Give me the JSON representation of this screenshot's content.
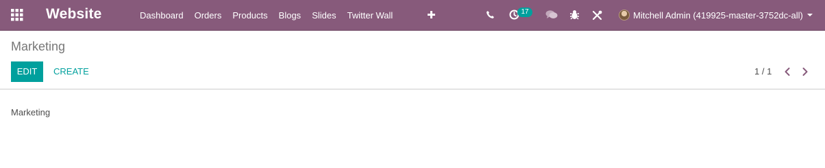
{
  "navbar": {
    "brand": "Website",
    "menu": [
      "Dashboard",
      "Orders",
      "Products",
      "Blogs",
      "Slides",
      "Twitter Wall"
    ],
    "activity_count": "17",
    "user_name": "Mitchell Admin (419925-master-3752dc-all)",
    "icons": [
      "apps-grid-icon",
      "plus-icon",
      "phone-icon",
      "clock-icon",
      "chat-icon",
      "bug-icon",
      "tools-icon",
      "chevron-down-icon"
    ]
  },
  "control_panel": {
    "breadcrumb": "Marketing",
    "edit_label": "EDIT",
    "create_label": "CREATE",
    "pager": "1 / 1"
  },
  "record": {
    "name": "Marketing"
  },
  "colors": {
    "navbar": "#875a7b",
    "primary": "#00a09d",
    "text": "#4c4c4c",
    "breadcrumb": "#777777",
    "pager_arrows": "#875a7b"
  }
}
